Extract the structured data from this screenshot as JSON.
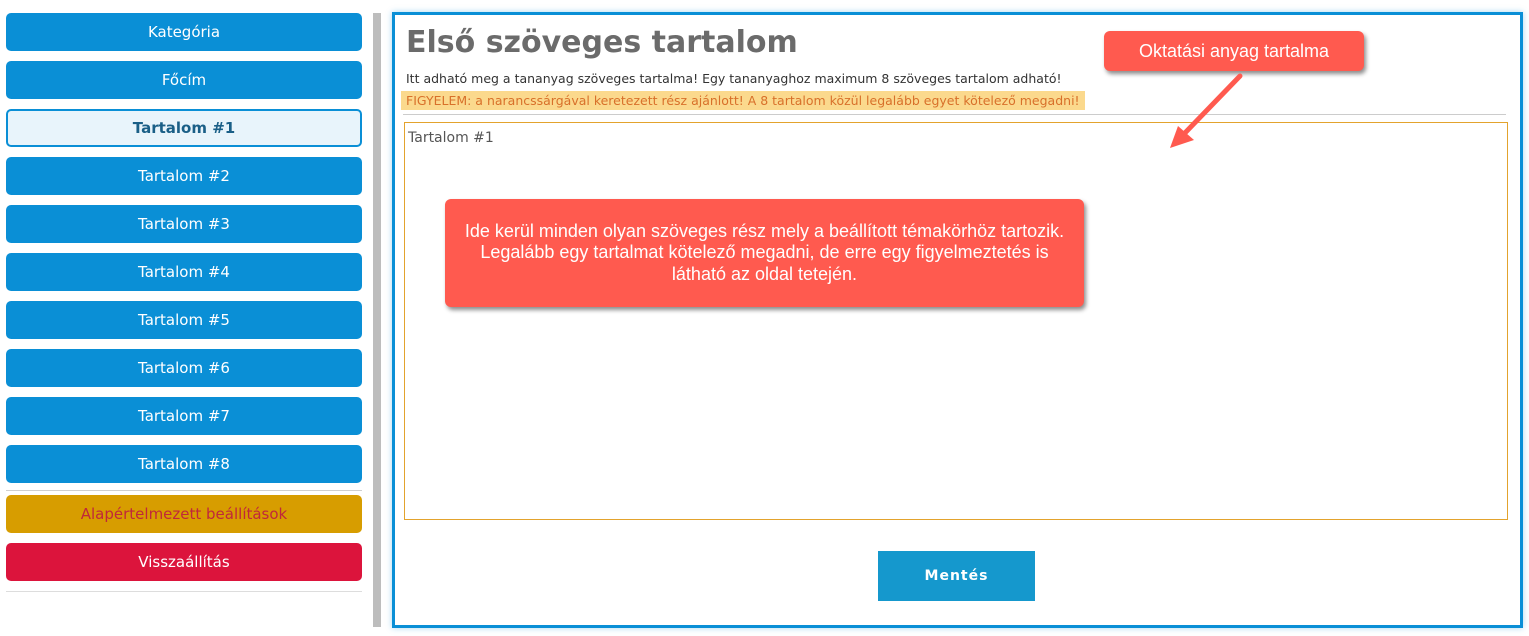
{
  "sidebar": {
    "items": [
      {
        "label": "Kategória"
      },
      {
        "label": "Főcím"
      },
      {
        "label": "Tartalom #1"
      },
      {
        "label": "Tartalom #2"
      },
      {
        "label": "Tartalom #3"
      },
      {
        "label": "Tartalom #4"
      },
      {
        "label": "Tartalom #5"
      },
      {
        "label": "Tartalom #6"
      },
      {
        "label": "Tartalom #7"
      },
      {
        "label": "Tartalom #8"
      }
    ],
    "active_item": "Tartalom #1",
    "defaults_label": "Alapértelmezett beállítások",
    "reset_label": "Visszaállítás"
  },
  "main": {
    "title": "Első szöveges tartalom",
    "description": "Itt adható meg a tananyag szöveges tartalma! Egy tananyaghoz maximum 8 szöveges tartalom adható!",
    "warning": "FIGYELEM: a narancssárgával keretezett rész ajánlott! A 8 tartalom közül legalább egyet kötelező megadni!",
    "editor_label": "Tartalom #1",
    "save_label": "Mentés"
  },
  "annotations": {
    "top": "Oktatási anyag tartalma",
    "middle": "Ide kerül minden olyan szöveges rész mely a beállított témakörhöz tartozik. Legalább egy tartalmat kötelező megadni, de erre egy figyelmeztetés is látható az oldal tetején."
  },
  "colors": {
    "primary": "#0a8fd6",
    "warning_bg": "#fbd98d",
    "warning_text": "#d8702a",
    "defaults_btn": "#d79d00",
    "reset_btn": "#dc143c",
    "callout": "#ff5a4f",
    "editor_border": "#e3a32d"
  }
}
